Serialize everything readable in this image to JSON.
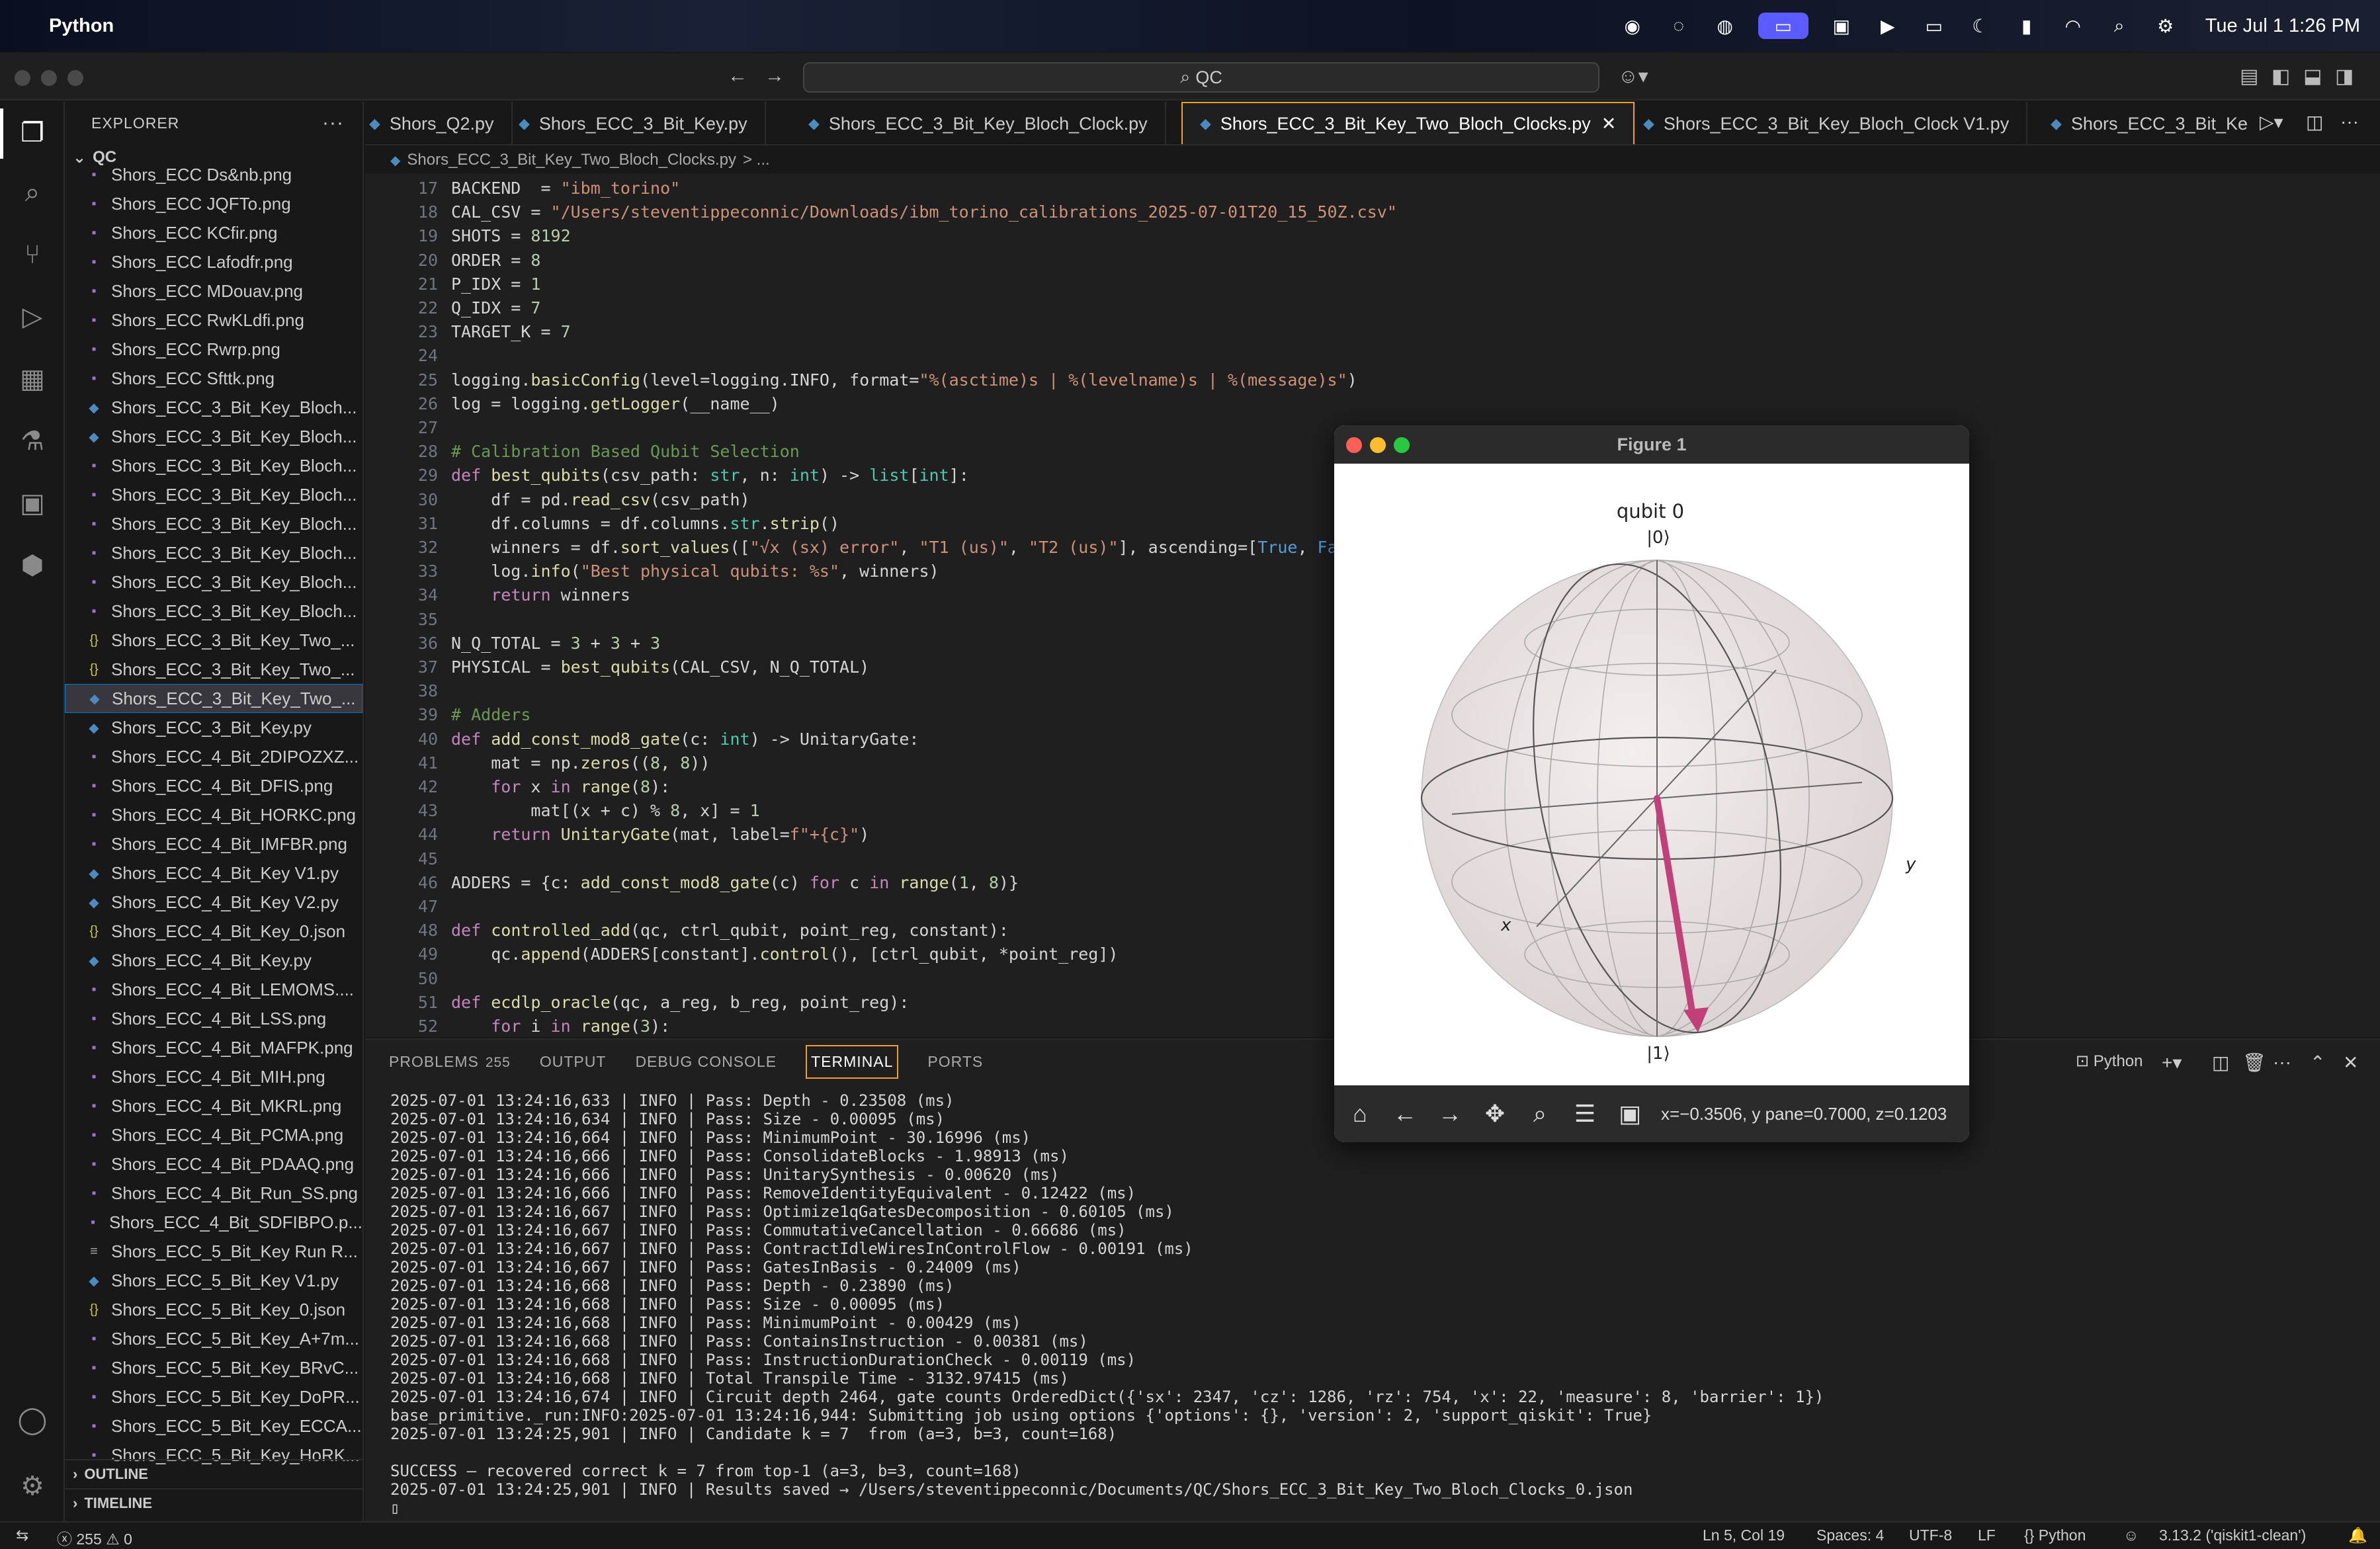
{
  "menubar": {
    "app": "Python",
    "clock": "Tue Jul 1  1:26 PM"
  },
  "search": {
    "value": "QC"
  },
  "explorer": {
    "title": "EXPLORER",
    "folder": "QC",
    "files": [
      {
        "name": "Shors_ECC Ds&nb.png",
        "type": "png"
      },
      {
        "name": "Shors_ECC JQFTo.png",
        "type": "png"
      },
      {
        "name": "Shors_ECC KCfir.png",
        "type": "png"
      },
      {
        "name": "Shors_ECC Lafodfr.png",
        "type": "png"
      },
      {
        "name": "Shors_ECC MDouav.png",
        "type": "png"
      },
      {
        "name": "Shors_ECC RwKLdfi.png",
        "type": "png"
      },
      {
        "name": "Shors_ECC Rwrp.png",
        "type": "png"
      },
      {
        "name": "Shors_ECC Sfttk.png",
        "type": "png"
      },
      {
        "name": "Shors_ECC_3_Bit_Key_Bloch...",
        "type": "py"
      },
      {
        "name": "Shors_ECC_3_Bit_Key_Bloch...",
        "type": "py"
      },
      {
        "name": "Shors_ECC_3_Bit_Key_Bloch...",
        "type": "png"
      },
      {
        "name": "Shors_ECC_3_Bit_Key_Bloch...",
        "type": "png"
      },
      {
        "name": "Shors_ECC_3_Bit_Key_Bloch...",
        "type": "png"
      },
      {
        "name": "Shors_ECC_3_Bit_Key_Bloch...",
        "type": "png"
      },
      {
        "name": "Shors_ECC_3_Bit_Key_Bloch...",
        "type": "png"
      },
      {
        "name": "Shors_ECC_3_Bit_Key_Bloch...",
        "type": "png"
      },
      {
        "name": "Shors_ECC_3_Bit_Key_Two_...",
        "type": "json"
      },
      {
        "name": "Shors_ECC_3_Bit_Key_Two_...",
        "type": "json"
      },
      {
        "name": "Shors_ECC_3_Bit_Key_Two_...",
        "type": "py",
        "selected": true
      },
      {
        "name": "Shors_ECC_3_Bit_Key.py",
        "type": "py"
      },
      {
        "name": "Shors_ECC_4_Bit_2DIPOZXZ...",
        "type": "png"
      },
      {
        "name": "Shors_ECC_4_Bit_DFIS.png",
        "type": "png"
      },
      {
        "name": "Shors_ECC_4_Bit_HORKC.png",
        "type": "png"
      },
      {
        "name": "Shors_ECC_4_Bit_IMFBR.png",
        "type": "png"
      },
      {
        "name": "Shors_ECC_4_Bit_Key V1.py",
        "type": "py"
      },
      {
        "name": "Shors_ECC_4_Bit_Key V2.py",
        "type": "py"
      },
      {
        "name": "Shors_ECC_4_Bit_Key_0.json",
        "type": "json"
      },
      {
        "name": "Shors_ECC_4_Bit_Key.py",
        "type": "py"
      },
      {
        "name": "Shors_ECC_4_Bit_LEMOMS....",
        "type": "png"
      },
      {
        "name": "Shors_ECC_4_Bit_LSS.png",
        "type": "png"
      },
      {
        "name": "Shors_ECC_4_Bit_MAFPK.png",
        "type": "png"
      },
      {
        "name": "Shors_ECC_4_Bit_MIH.png",
        "type": "png"
      },
      {
        "name": "Shors_ECC_4_Bit_MKRL.png",
        "type": "png"
      },
      {
        "name": "Shors_ECC_4_Bit_PCMA.png",
        "type": "png"
      },
      {
        "name": "Shors_ECC_4_Bit_PDAAQ.png",
        "type": "png"
      },
      {
        "name": "Shors_ECC_4_Bit_Run_SS.png",
        "type": "png"
      },
      {
        "name": "Shors_ECC_4_Bit_SDFIBPO.p...",
        "type": "png"
      },
      {
        "name": "Shors_ECC_5_Bit_Key Run R...",
        "type": "txt"
      },
      {
        "name": "Shors_ECC_5_Bit_Key V1.py",
        "type": "py"
      },
      {
        "name": "Shors_ECC_5_Bit_Key_0.json",
        "type": "json"
      },
      {
        "name": "Shors_ECC_5_Bit_Key_A+7m...",
        "type": "png"
      },
      {
        "name": "Shors_ECC_5_Bit_Key_BRvC...",
        "type": "png"
      },
      {
        "name": "Shors_ECC_5_Bit_Key_DoPR...",
        "type": "png"
      },
      {
        "name": "Shors_ECC_5_Bit_Key_ECCA...",
        "type": "png"
      },
      {
        "name": "Shors_ECC_5_Bit_Key_HoRK...",
        "type": "png"
      }
    ],
    "outline": "OUTLINE",
    "timeline": "TIMELINE"
  },
  "tabs": [
    {
      "label": "Shors_Q2.py"
    },
    {
      "label": "Shors_ECC_3_Bit_Key.py"
    },
    {
      "label": "Shors_ECC_3_Bit_Key_Bloch_Clock.py"
    },
    {
      "label": "Shors_ECC_3_Bit_Key_Two_Bloch_Clocks.py",
      "active": true
    },
    {
      "label": "Shors_ECC_3_Bit_Key_Bloch_Clock V1.py"
    },
    {
      "label": "Shors_ECC_3_Bit_Ke"
    }
  ],
  "breadcrumb": {
    "file": "Shors_ECC_3_Bit_Key_Two_Bloch_Clocks.py",
    "rest": "> ..."
  },
  "code": [
    {
      "n": "17",
      "t": "BACKEND  = \"ibm_torino\""
    },
    {
      "n": "18",
      "t": "CAL_CSV = \"/Users/steventippeconnic/Downloads/ibm_torino_calibrations_2025-07-01T20_15_50Z.csv\""
    },
    {
      "n": "19",
      "t": "SHOTS = 8192"
    },
    {
      "n": "20",
      "t": "ORDER = 8"
    },
    {
      "n": "21",
      "t": "P_IDX = 1"
    },
    {
      "n": "22",
      "t": "Q_IDX = 7"
    },
    {
      "n": "23",
      "t": "TARGET_K = 7"
    },
    {
      "n": "24",
      "t": ""
    },
    {
      "n": "25",
      "t": "logging.basicConfig(level=logging.INFO, format=\"%(asctime)s | %(levelname)s | %(message)s\")"
    },
    {
      "n": "26",
      "t": "log = logging.getLogger(__name__)"
    },
    {
      "n": "27",
      "t": ""
    },
    {
      "n": "28",
      "t": "# Calibration Based Qubit Selection"
    },
    {
      "n": "29",
      "t": "def best_qubits(csv_path: str, n: int) -> list[int]:"
    },
    {
      "n": "30",
      "t": "    df = pd.read_csv(csv_path)"
    },
    {
      "n": "31",
      "t": "    df.columns = df.columns.str.strip()"
    },
    {
      "n": "32",
      "t": "    winners = df.sort_values([\"√x (sx) error\", \"T1 (us)\", \"T2 (us)\"], ascending=[True, False"
    },
    {
      "n": "33",
      "t": "    log.info(\"Best physical qubits: %s\", winners)"
    },
    {
      "n": "34",
      "t": "    return winners"
    },
    {
      "n": "35",
      "t": ""
    },
    {
      "n": "36",
      "t": "N_Q_TOTAL = 3 + 3 + 3"
    },
    {
      "n": "37",
      "t": "PHYSICAL = best_qubits(CAL_CSV, N_Q_TOTAL)"
    },
    {
      "n": "38",
      "t": ""
    },
    {
      "n": "39",
      "t": "# Adders"
    },
    {
      "n": "40",
      "t": "def add_const_mod8_gate(c: int) -> UnitaryGate:"
    },
    {
      "n": "41",
      "t": "    mat = np.zeros((8, 8))"
    },
    {
      "n": "42",
      "t": "    for x in range(8):"
    },
    {
      "n": "43",
      "t": "        mat[(x + c) % 8, x] = 1"
    },
    {
      "n": "44",
      "t": "    return UnitaryGate(mat, label=f\"+{c}\")"
    },
    {
      "n": "45",
      "t": ""
    },
    {
      "n": "46",
      "t": "ADDERS = {c: add_const_mod8_gate(c) for c in range(1, 8)}"
    },
    {
      "n": "47",
      "t": ""
    },
    {
      "n": "48",
      "t": "def controlled_add(qc, ctrl_qubit, point_reg, constant):"
    },
    {
      "n": "49",
      "t": "    qc.append(ADDERS[constant].control(), [ctrl_qubit, *point_reg])"
    },
    {
      "n": "50",
      "t": ""
    },
    {
      "n": "51",
      "t": "def ecdlp_oracle(qc, a_reg, b_reg, point_reg):"
    },
    {
      "n": "52",
      "t": "    for i in range(3):"
    }
  ],
  "panel": {
    "tabs": [
      "PROBLEMS",
      "OUTPUT",
      "DEBUG CONSOLE",
      "TERMINAL",
      "PORTS"
    ],
    "problems_count": "255",
    "shell": "Python"
  },
  "terminal": [
    "2025-07-01 13:24:16,633 | INFO | Pass: Depth - 0.23508 (ms)",
    "2025-07-01 13:24:16,634 | INFO | Pass: Size - 0.00095 (ms)",
    "2025-07-01 13:24:16,664 | INFO | Pass: MinimumPoint - 30.16996 (ms)",
    "2025-07-01 13:24:16,666 | INFO | Pass: ConsolidateBlocks - 1.98913 (ms)",
    "2025-07-01 13:24:16,666 | INFO | Pass: UnitarySynthesis - 0.00620 (ms)",
    "2025-07-01 13:24:16,666 | INFO | Pass: RemoveIdentityEquivalent - 0.12422 (ms)",
    "2025-07-01 13:24:16,667 | INFO | Pass: Optimize1qGatesDecomposition - 0.60105 (ms)",
    "2025-07-01 13:24:16,667 | INFO | Pass: CommutativeCancellation - 0.66686 (ms)",
    "2025-07-01 13:24:16,667 | INFO | Pass: ContractIdleWiresInControlFlow - 0.00191 (ms)",
    "2025-07-01 13:24:16,667 | INFO | Pass: GatesInBasis - 0.24009 (ms)",
    "2025-07-01 13:24:16,668 | INFO | Pass: Depth - 0.23890 (ms)",
    "2025-07-01 13:24:16,668 | INFO | Pass: Size - 0.00095 (ms)",
    "2025-07-01 13:24:16,668 | INFO | Pass: MinimumPoint - 0.00429 (ms)",
    "2025-07-01 13:24:16,668 | INFO | Pass: ContainsInstruction - 0.00381 (ms)",
    "2025-07-01 13:24:16,668 | INFO | Pass: InstructionDurationCheck - 0.00119 (ms)",
    "2025-07-01 13:24:16,668 | INFO | Total Transpile Time - 3132.97415 (ms)",
    "2025-07-01 13:24:16,674 | INFO | Circuit depth 2464, gate counts OrderedDict({'sx': 2347, 'cz': 1286, 'rz': 754, 'x': 22, 'measure': 8, 'barrier': 1})",
    "base_primitive._run:INFO:2025-07-01 13:24:16,944: Submitting job using options {'options': {}, 'version': 2, 'support_qiskit': True}",
    "2025-07-01 13:24:25,901 | INFO | Candidate k = 7  from (a=3, b=3, count=168)",
    "",
    "SUCCESS — recovered correct k = 7 from top-1 (a=3, b=3, count=168)",
    "2025-07-01 13:24:25,901 | INFO | Results saved → /Users/steventippeconnic/Documents/QC/Shors_ECC_3_Bit_Key_Two_Bloch_Clocks_0.json"
  ],
  "figure": {
    "title": "Figure 1",
    "plot_title": "qubit 0",
    "ket0": "|0⟩",
    "ket1": "|1⟩",
    "xlabel": "x",
    "ylabel": "y",
    "coords": "x=−0.3506, y pane=0.7000, z=0.1203",
    "vector_color": "#c2407a"
  },
  "status": {
    "errors": "255",
    "warnings": "0",
    "position": "Ln 5, Col 19",
    "spaces": "Spaces: 4",
    "encoding": "UTF-8",
    "eol": "LF",
    "lang": "Python",
    "interpreter": "3.13.2 ('qiskit1-clean')"
  }
}
